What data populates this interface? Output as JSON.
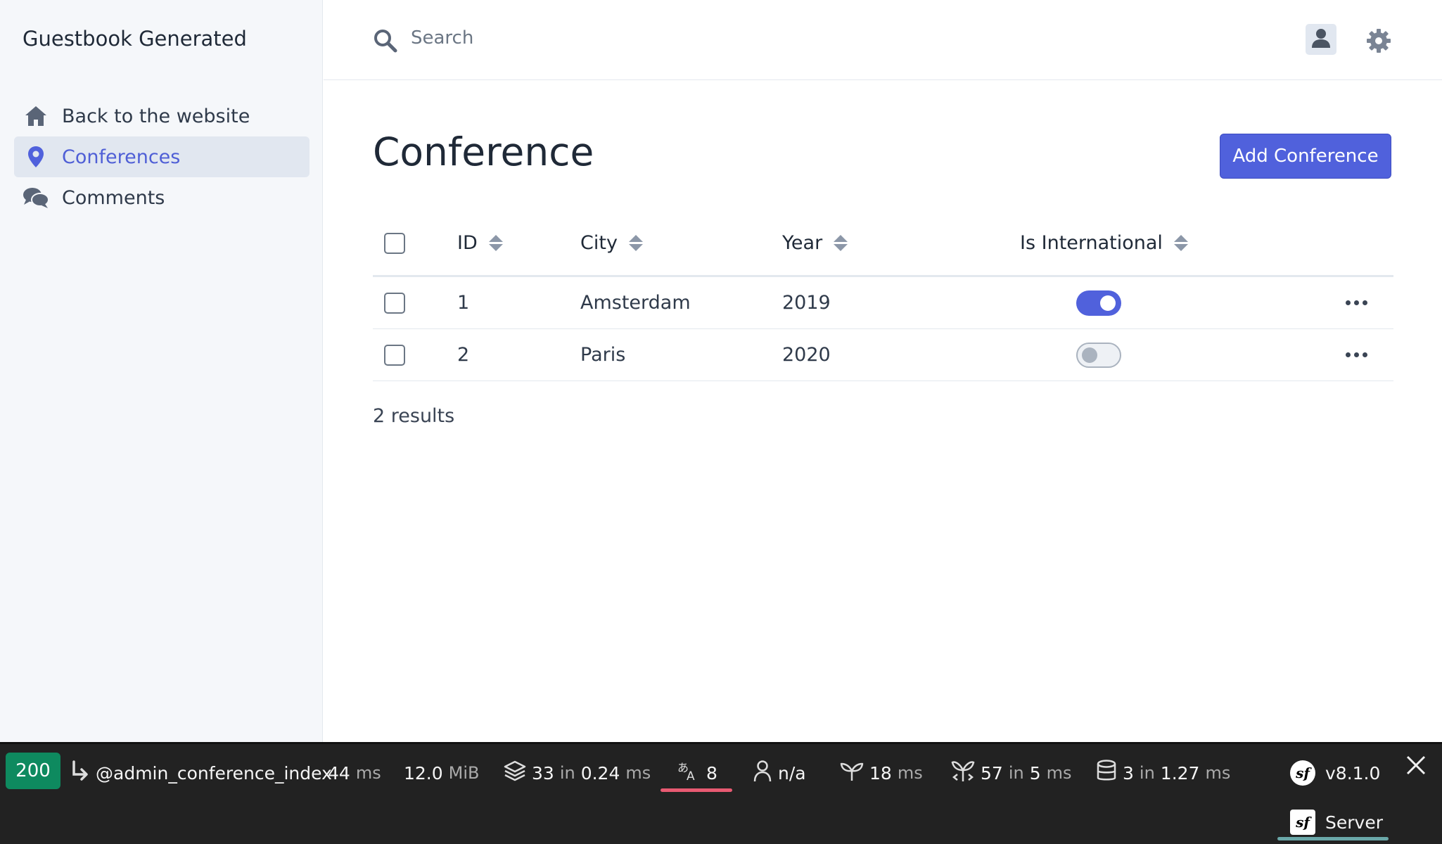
{
  "app": {
    "brand": "Guestbook Generated"
  },
  "sidebar": {
    "items": [
      {
        "label": "Back to the website",
        "icon": "home-icon"
      },
      {
        "label": "Conferences",
        "icon": "map-pin-icon",
        "active": true
      },
      {
        "label": "Comments",
        "icon": "comments-icon"
      }
    ]
  },
  "header": {
    "search_placeholder": "Search"
  },
  "main": {
    "title": "Conference",
    "add_button": "Add Conference",
    "columns": [
      "ID",
      "City",
      "Year",
      "Is International"
    ],
    "rows": [
      {
        "id": "1",
        "city": "Amsterdam",
        "year": "2019",
        "is_international": true
      },
      {
        "id": "2",
        "city": "Paris",
        "year": "2020",
        "is_international": false
      }
    ],
    "results": "2 results"
  },
  "debug_toolbar": {
    "status_code": "200",
    "route": "@admin_conference_index",
    "time_value": "44",
    "time_unit": "ms",
    "memory_value": "12.0",
    "memory_unit": "MiB",
    "cache_count": "33",
    "cache_in": "in",
    "cache_time": "0.24",
    "cache_unit": "ms",
    "translations": "8",
    "user": "n/a",
    "twig_time": "18",
    "twig_unit": "ms",
    "events_count": "57",
    "events_in": "in",
    "events_time": "5",
    "events_unit": "ms",
    "db_queries": "3",
    "db_in": "in",
    "db_time": "1.27",
    "db_unit": "ms",
    "symfony_version": "v8.1.0",
    "server_label": "Server",
    "accent_status": "#0e8a5f",
    "accent_translation": "#e85a72"
  },
  "colors": {
    "primary": "#5061dc",
    "sidebar_bg": "#f5f7fa",
    "toolbar_bg": "#222222"
  }
}
